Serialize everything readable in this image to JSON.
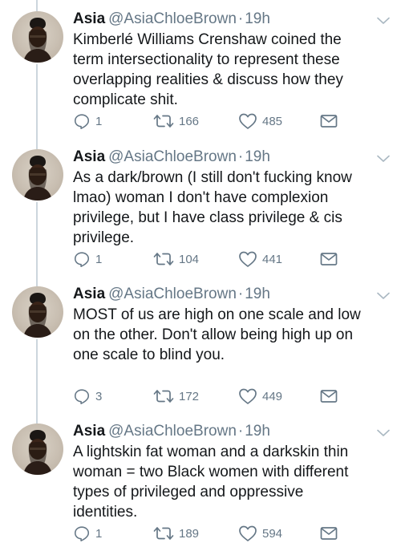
{
  "tweets": [
    {
      "name": "Asia",
      "handle": "@AsiaChloeBrown",
      "sep": "·",
      "time": "19h",
      "text": "Kimberlé Williams Crenshaw coined the\nterm intersectionality to represent these\noverlapping realities & discuss how they\ncomplicate shit.",
      "replies": "1",
      "retweets": "166",
      "likes": "485"
    },
    {
      "name": "Asia",
      "handle": "@AsiaChloeBrown",
      "sep": "·",
      "time": "19h",
      "text": "As a dark/brown (I still don't fucking know\nlmao) woman I don't have complexion\nprivilege, but I have class privilege & cis\nprivilege.",
      "replies": "1",
      "retweets": "104",
      "likes": "441"
    },
    {
      "name": "Asia",
      "handle": "@AsiaChloeBrown",
      "sep": "·",
      "time": "19h",
      "text": "MOST of us are high on one scale and low\non the other. Don't allow being high up on\none scale to blind you.",
      "replies": "3",
      "retweets": "172",
      "likes": "449"
    },
    {
      "name": "Asia",
      "handle": "@AsiaChloeBrown",
      "sep": "·",
      "time": "19h",
      "text": "A lightskin fat woman and a darkskin thin\nwoman = two Black women with different\ntypes of privileged and oppressive\nidentities.",
      "replies": "1",
      "retweets": "189",
      "likes": "594"
    }
  ],
  "icons": {
    "reply": "reply-icon",
    "retweet": "retweet-icon",
    "like": "heart-icon",
    "dm": "envelope-icon",
    "menu": "chevron-down-icon"
  },
  "colors": {
    "text": "#14171a",
    "muted": "#657786",
    "thread_line": "#ccd6dd"
  }
}
